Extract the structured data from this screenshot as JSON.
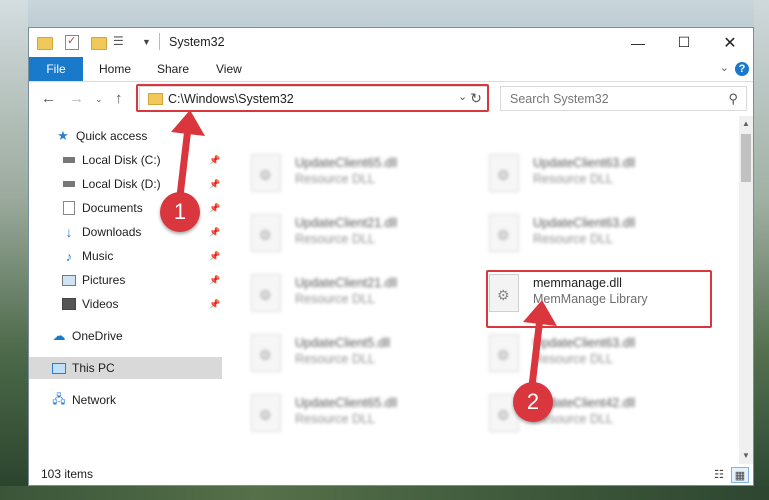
{
  "window": {
    "title": "System32"
  },
  "ribbon": {
    "tabs": [
      "File",
      "Home",
      "Share",
      "View"
    ],
    "help": "?"
  },
  "address": {
    "path": "C:\\Windows\\System32"
  },
  "search": {
    "placeholder": "Search System32"
  },
  "nav": {
    "items": [
      {
        "label": "Quick access",
        "icon": "star-icon"
      },
      {
        "label": "Local Disk (C:)",
        "icon": "drive-icon",
        "pinned": true
      },
      {
        "label": "Local Disk (D:)",
        "icon": "drive-icon",
        "pinned": true
      },
      {
        "label": "Documents",
        "icon": "documents-icon",
        "pinned": true
      },
      {
        "label": "Downloads",
        "icon": "download-icon",
        "pinned": true
      },
      {
        "label": "Music",
        "icon": "music-icon",
        "pinned": true
      },
      {
        "label": "Pictures",
        "icon": "pictures-icon",
        "pinned": true
      },
      {
        "label": "Videos",
        "icon": "videos-icon",
        "pinned": true
      },
      {
        "label": "OneDrive",
        "icon": "cloud-icon"
      },
      {
        "label": "This PC",
        "icon": "computer-icon",
        "selected": true
      },
      {
        "label": "Network",
        "icon": "network-icon"
      }
    ]
  },
  "files": [
    {
      "name": "UpdateClient65.dll",
      "type": "Resource DLL"
    },
    {
      "name": "UpdateClient63.dll",
      "type": "Resource DLL"
    },
    {
      "name": "UpdateClient21.dll",
      "type": "Resource DLL"
    },
    {
      "name": "UpdateClient63.dll",
      "type": "Resource DLL"
    },
    {
      "name": "UpdateClient21.dll",
      "type": "Resource DLL"
    },
    {
      "name": "memmanage.dll",
      "type": "MemManage Library",
      "highlighted": true
    },
    {
      "name": "UpdateClient5.dll",
      "type": "Resource DLL"
    },
    {
      "name": "UpdateClient63.dll",
      "type": "Resource DLL"
    },
    {
      "name": "UpdateClient65.dll",
      "type": "Resource DLL"
    },
    {
      "name": "UpdateClient42.dll",
      "type": "Resource DLL"
    }
  ],
  "status": {
    "item_count": "103 items"
  },
  "callouts": [
    "1",
    "2"
  ],
  "colors": {
    "accent": "#1979ca",
    "callout": "#d9363e",
    "selected": "#d9d9d9"
  }
}
